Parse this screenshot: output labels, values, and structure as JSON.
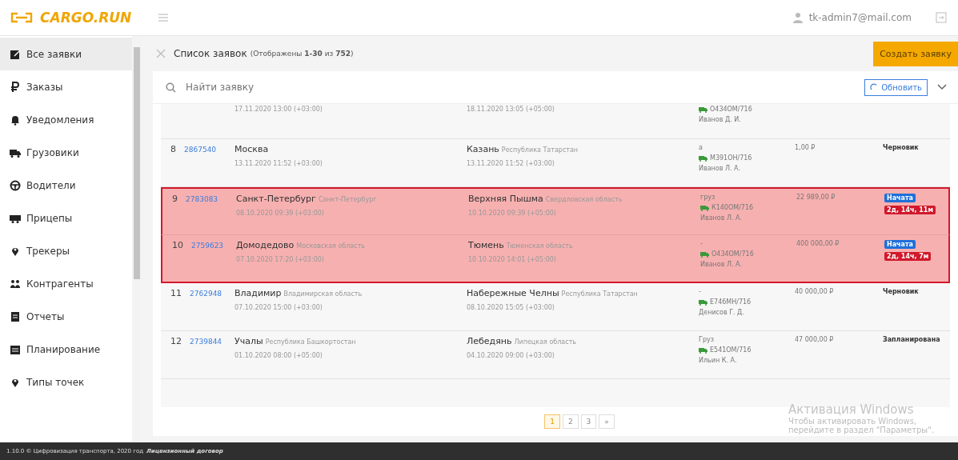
{
  "header": {
    "logo": "CARGO.RUN",
    "user": "tk-admin7@mail.com"
  },
  "sidebar": {
    "items": [
      {
        "label": "Все заявки",
        "kind": "note",
        "selected": true
      },
      {
        "label": "Заказы",
        "kind": "ruble",
        "selected": false
      },
      {
        "label": "Уведомления",
        "kind": "bell",
        "selected": false
      },
      {
        "label": "Грузовики",
        "kind": "truck",
        "selected": false
      },
      {
        "label": "Водители",
        "kind": "wheel",
        "selected": false
      },
      {
        "label": "Прицепы",
        "kind": "trailer",
        "selected": false
      },
      {
        "label": "Трекеры",
        "kind": "pin",
        "selected": false
      },
      {
        "label": "Контрагенты",
        "kind": "people",
        "selected": false
      },
      {
        "label": "Отчеты",
        "kind": "report",
        "selected": false
      },
      {
        "label": "Планирование",
        "kind": "calendar",
        "selected": false
      },
      {
        "label": "Типы точек",
        "kind": "pin",
        "selected": false
      }
    ]
  },
  "list": {
    "title": "Список заявок",
    "summary": "(Отображены **1-30** из **752**)",
    "create_button": "Создать заявку",
    "search": {
      "placeholder": "Найти заявку"
    },
    "refresh_button": "Обновить"
  },
  "table": {
    "rows": [
      {
        "number": "",
        "id": "",
        "from_city": "",
        "from_region": "",
        "from_date": "17.11.2020 13:00 (+03:00)",
        "to_city": "",
        "to_region": "",
        "to_date": "18.11.2020 13:05 (+05:00)",
        "cargo": "",
        "vehicle": "О434ОМ/716",
        "driver": "Иванов Д. И.",
        "price": "",
        "status": "",
        "highlighted": false,
        "badges": []
      },
      {
        "number": "8",
        "id": "2867540",
        "from_city": "Москва",
        "from_region": "",
        "from_date": "13.11.2020 11:52 (+03:00)",
        "to_city": "Казань",
        "to_region": "Республика Татарстан",
        "to_date": "13.11.2020 11:52 (+03:00)",
        "cargo": "а",
        "vehicle": "М391ОН/716",
        "driver": "Иванов Л. А.",
        "price": "1,00 ₽",
        "status": "Черновик",
        "highlighted": false,
        "badges": []
      },
      {
        "number": "9",
        "id": "2783083",
        "from_city": "Санкт-Петербург",
        "from_region": "Санкт-Петербург",
        "from_date": "08.10.2020 09:39 (+03:00)",
        "to_city": "Верхняя Пышма",
        "to_region": "Свердловская область",
        "to_date": "10.10.2020 09:39 (+05:00)",
        "cargo": "груз",
        "vehicle": "К140ОМ/716",
        "driver": "Иванов Л. А.",
        "price": "22 989,00 ₽",
        "status": "",
        "highlighted": true,
        "badges": [
          {
            "text": "Начата",
            "color": "#1e6fd9"
          },
          {
            "text": "2д, 14ч, 11м",
            "color": "#d0192b"
          }
        ]
      },
      {
        "number": "10",
        "id": "2759623",
        "from_city": "Домодедово",
        "from_region": "Московская область",
        "from_date": "07.10.2020 17:20 (+03:00)",
        "to_city": "Тюмень",
        "to_region": "Тюменская область",
        "to_date": "10.10.2020 14:01 (+05:00)",
        "cargo": "-",
        "vehicle": "О434ОМ/716",
        "driver": "Иванов Л. А.",
        "price": "400 000,00 ₽",
        "status": "",
        "highlighted": true,
        "badges": [
          {
            "text": "Начата",
            "color": "#1e6fd9"
          },
          {
            "text": "2д, 14ч, 7м",
            "color": "#d0192b"
          }
        ]
      },
      {
        "number": "11",
        "id": "2762948",
        "from_city": "Владимир",
        "from_region": "Владимирская область",
        "from_date": "07.10.2020 15:00 (+03:00)",
        "to_city": "Набережные Челны",
        "to_region": "Республика Татарстан",
        "to_date": "08.10.2020 15:05 (+03:00)",
        "cargo": "-",
        "vehicle": "Е746МН/716",
        "driver": "Денисов Г. Д.",
        "price": "40 000,00 ₽",
        "status": "Черновик",
        "highlighted": false,
        "badges": []
      },
      {
        "number": "12",
        "id": "2739844",
        "from_city": "Учалы",
        "from_region": "Республика Башкортостан",
        "from_date": "01.10.2020 08:00 (+05:00)",
        "to_city": "Лебедянь",
        "to_region": "Липецкая область",
        "to_date": "04.10.2020 09:00 (+03:00)",
        "cargo": "Груз",
        "vehicle": "Е541ОМ/716",
        "driver": "Ильин К. А.",
        "price": "47 000,00 ₽",
        "status": "Запланирована",
        "highlighted": false,
        "badges": []
      }
    ]
  },
  "pagination": [
    {
      "label": "1",
      "selected": true
    },
    {
      "label": "2",
      "selected": false
    },
    {
      "label": "3",
      "selected": false
    },
    {
      "label": "»",
      "selected": false
    }
  ],
  "windows_notice": {
    "title": "Активация Windows",
    "text": "Чтобы активировать Windows, перейдите в раздел \"Параметры\"."
  },
  "footer": {
    "text": "1.10.0 © Цифровизация транспорта, 2020 год",
    "link": "Лицензионный договор"
  }
}
